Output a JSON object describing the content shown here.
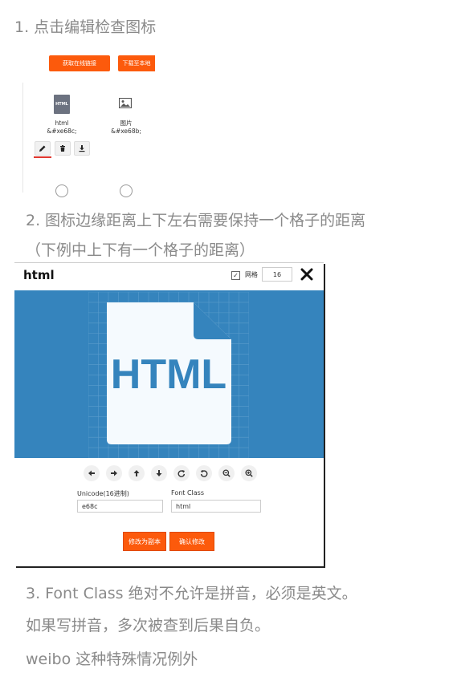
{
  "steps": {
    "step1": "1. 点击编辑检查图标",
    "step2_line1": "2. 图标边缘距离上下左右需要保持一个格子的距离",
    "step2_line2": "（下例中上下有一个格子的距离）",
    "step3_line1": "3. Font Class 绝对不允许是拼音，必须是英文。",
    "step3_line2": "如果写拼音，多次被查到后果自负。",
    "step3_line3": "weibo 这种特殊情况例外"
  },
  "panel1": {
    "btn_online_link": "获取在线链接",
    "btn_download": "下载至本地",
    "icons": [
      {
        "name": "html",
        "code": "&#xe68c;",
        "glyph_text": "HTML"
      },
      {
        "name": "图片",
        "code": "&#xe68b;"
      }
    ],
    "tools": [
      "edit-icon",
      "trash-icon",
      "download-icon"
    ]
  },
  "dialog": {
    "title": "html",
    "grid_label": "网格",
    "grid_checked": true,
    "grid_size": "16",
    "icon_text": "HTML",
    "canvas_color": "#3584bd",
    "accent_color": "#fc5a0c",
    "controls": [
      "arrow-left-icon",
      "arrow-right-icon",
      "arrow-up-icon",
      "arrow-down-icon",
      "rotate-cw-icon",
      "rotate-ccw-icon",
      "zoom-out-icon",
      "zoom-in-icon"
    ],
    "unicode_label": "Unicode(16进制)",
    "unicode_value": "e68c",
    "fontclass_label": "Font Class",
    "fontclass_value": "html",
    "btn_save_copy": "修改为副本",
    "btn_confirm": "确认修改"
  }
}
